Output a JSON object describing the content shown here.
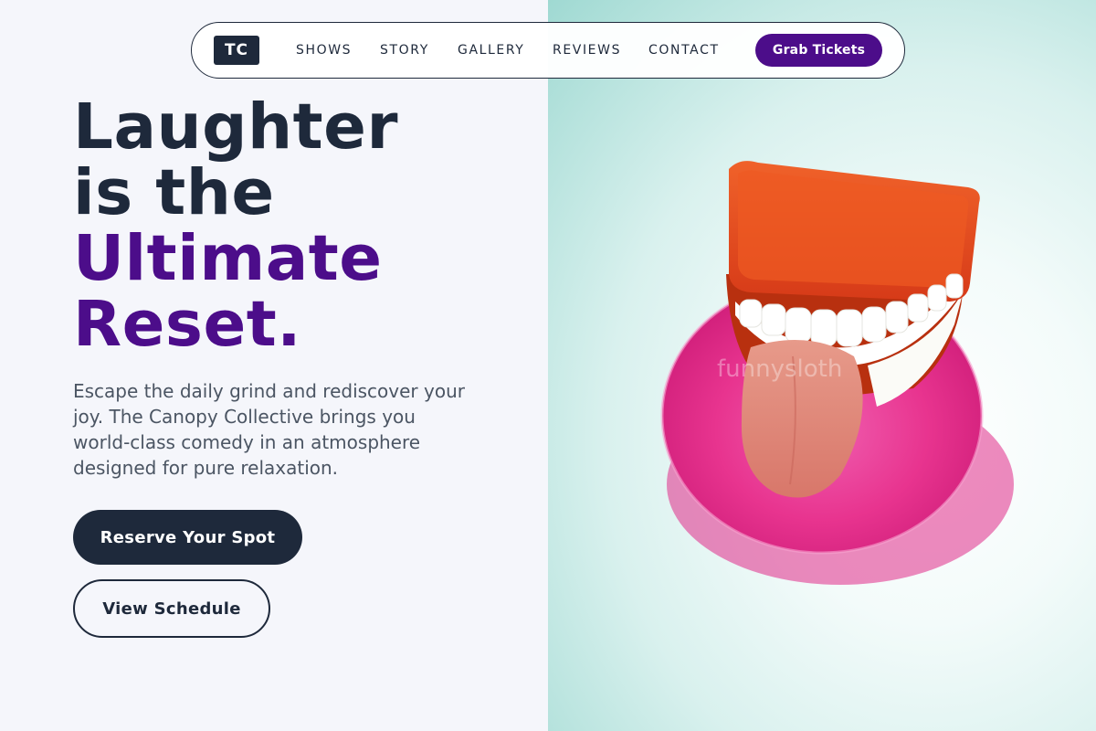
{
  "nav": {
    "logo": "TC",
    "links": [
      "SHOWS",
      "STORY",
      "GALLERY",
      "REVIEWS",
      "CONTACT"
    ],
    "cta": "Grab Tickets"
  },
  "hero": {
    "headline_line1": "Laughter",
    "headline_line2": "is the",
    "headline_line3": "Ultimate",
    "headline_line4": "Reset.",
    "subtext": "Escape the daily grind and rediscover your joy. The Canopy Collective brings you world-class comedy in an atmosphere designed for pure relaxation.",
    "primary_button": "Reserve Your Spot",
    "secondary_button": "View Schedule"
  },
  "image": {
    "watermark": "funnysloth"
  },
  "colors": {
    "dark": "#1e293b",
    "accent": "#4c0d8a",
    "background": "#f5f6fb"
  }
}
